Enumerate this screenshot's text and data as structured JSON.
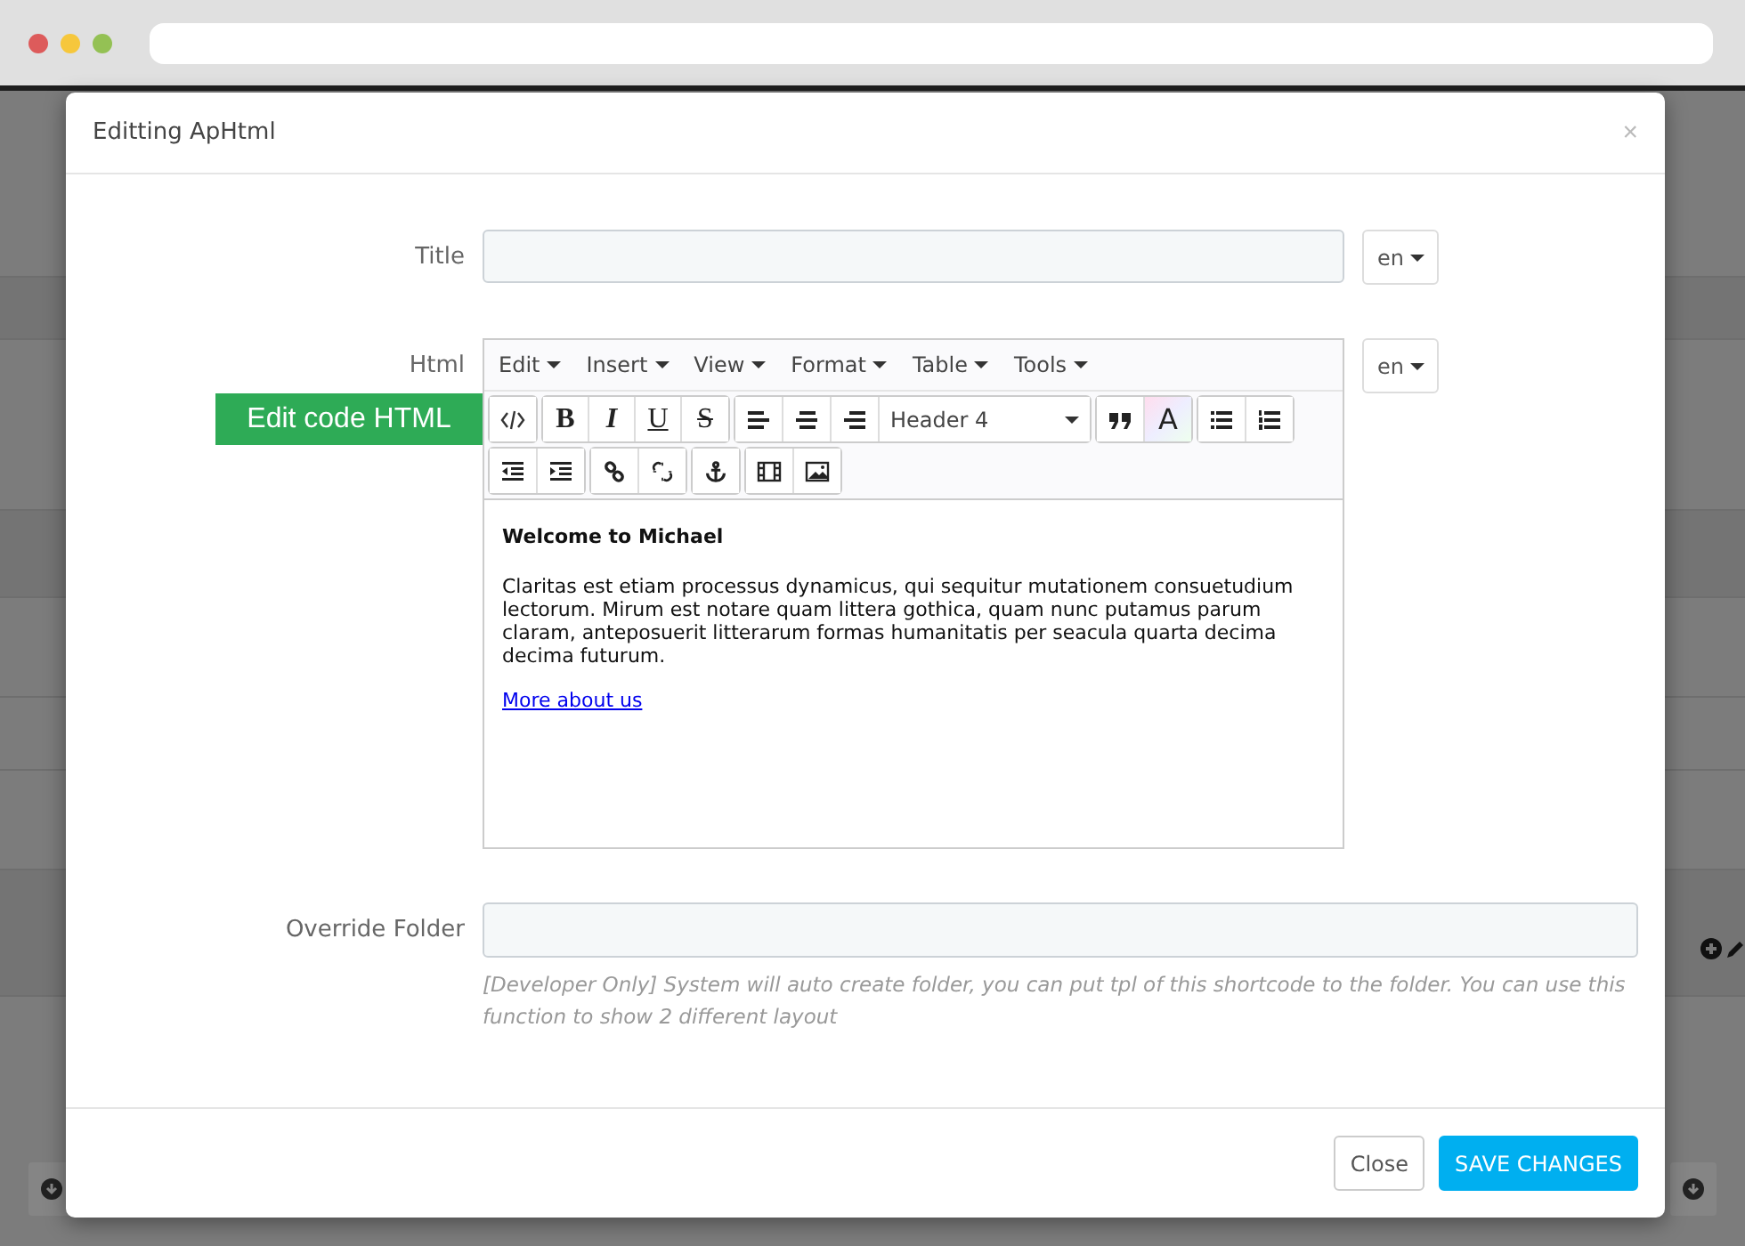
{
  "modal": {
    "title": "Editting ApHtml",
    "close_symbol": "×"
  },
  "title_field": {
    "label": "Title",
    "lang": "en"
  },
  "html_field": {
    "label": "Html",
    "lang": "en",
    "menus": [
      "Edit",
      "Insert",
      "View",
      "Format",
      "Table",
      "Tools"
    ],
    "format_letters": [
      "B",
      "I",
      "U",
      "S"
    ],
    "block_format": "Header 4",
    "color_letter": "A",
    "annotation": "Edit code HTML",
    "content": {
      "heading": "Welcome to Michael",
      "paragraph": "Claritas est etiam processus dynamicus, qui sequitur mutationem consuetudium lectorum. Mirum est notare quam littera gothica, quam nunc putamus parum claram, anteposuerit litterarum formas humanitatis per seacula quarta decima decima futurum.",
      "link": "More about us"
    }
  },
  "override_field": {
    "label": "Override Folder",
    "help": "[Developer Only] System will auto create folder, you can put tpl of this shortcode to the folder. You can use this function to show 2 different layout"
  },
  "buttons": [
    {
      "label": "Close",
      "kind": "default"
    },
    {
      "label": "SAVE CHANGES",
      "kind": "primary"
    }
  ]
}
